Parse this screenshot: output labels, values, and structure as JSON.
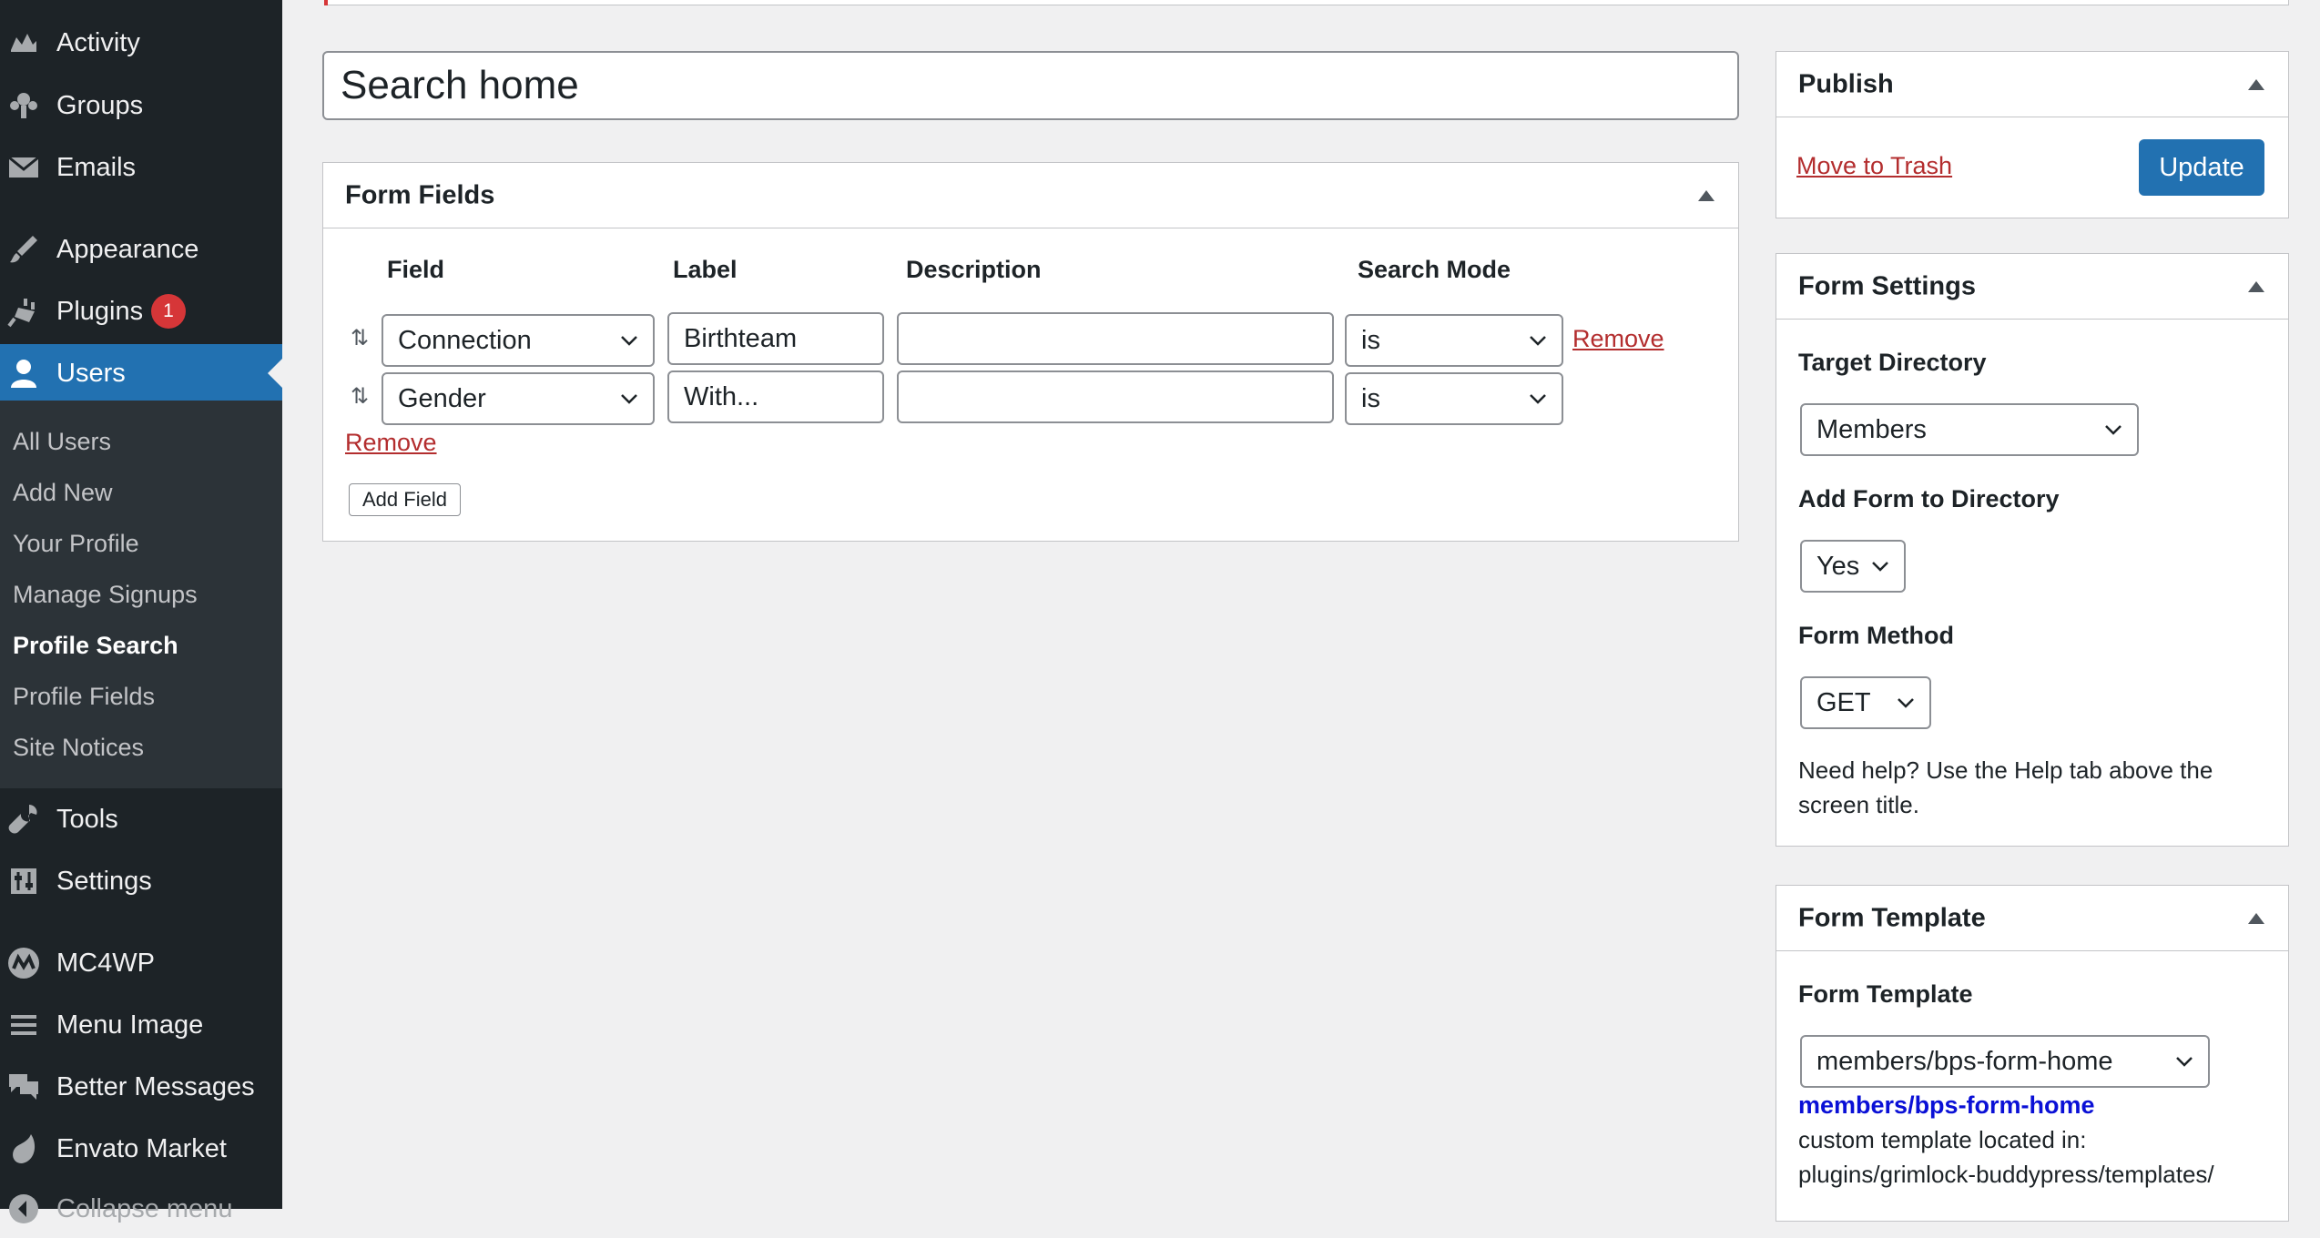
{
  "sidebar": {
    "items": [
      {
        "label": "Activity",
        "icon": "activity-icon"
      },
      {
        "label": "Groups",
        "icon": "groups-icon"
      },
      {
        "label": "Emails",
        "icon": "email-icon"
      },
      {
        "label": "Appearance",
        "icon": "paintbrush-icon"
      },
      {
        "label": "Plugins",
        "icon": "plugin-icon",
        "badge": "1"
      },
      {
        "label": "Users",
        "icon": "user-icon",
        "current": true
      },
      {
        "label": "Tools",
        "icon": "wrench-icon"
      },
      {
        "label": "Settings",
        "icon": "settings-icon"
      },
      {
        "label": "MC4WP",
        "icon": "mc4wp-icon"
      },
      {
        "label": "Menu Image",
        "icon": "menu-icon"
      },
      {
        "label": "Better Messages",
        "icon": "messages-icon"
      },
      {
        "label": "Envato Market",
        "icon": "leaf-icon"
      },
      {
        "label": "Collapse menu",
        "icon": "collapse-icon"
      }
    ],
    "submenu": [
      {
        "label": "All Users"
      },
      {
        "label": "Add New"
      },
      {
        "label": "Your Profile"
      },
      {
        "label": "Manage Signups"
      },
      {
        "label": "Profile Search",
        "current": true
      },
      {
        "label": "Profile Fields"
      },
      {
        "label": "Site Notices"
      }
    ]
  },
  "title_value": "Search home",
  "form_fields": {
    "title": "Form Fields",
    "columns": [
      "Field",
      "Label",
      "Description",
      "Search Mode"
    ],
    "rows": [
      {
        "field": "Connection",
        "label": "Birthteam",
        "description": "",
        "mode": "is",
        "remove": "Remove"
      },
      {
        "field": "Gender",
        "label": "With...",
        "description": "",
        "mode": "is",
        "remove": "Remove"
      }
    ],
    "add_field": "Add Field"
  },
  "publish": {
    "title": "Publish",
    "trash": "Move to Trash",
    "update": "Update"
  },
  "form_settings": {
    "title": "Form Settings",
    "target_label": "Target Directory",
    "target_value": "Members",
    "add_label": "Add Form to Directory",
    "add_value": "Yes",
    "method_label": "Form Method",
    "method_value": "GET",
    "help_line1": "Need help? Use the Help tab above the",
    "help_line2": "screen title."
  },
  "form_template": {
    "title": "Form Template",
    "label": "Form Template",
    "value": "members/bps-form-home",
    "link": "members/bps-form-home",
    "desc_line1": "custom template located in:",
    "desc_line2": "plugins/grimlock-buddypress/templates/"
  },
  "colors": {
    "sidebar": "#1d2327",
    "accent": "#2271b1",
    "danger": "#b32d2e",
    "badge": "#d63638"
  }
}
